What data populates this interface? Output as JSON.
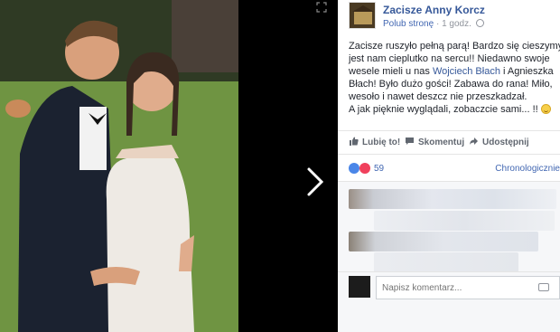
{
  "header": {
    "page_name": "Zacisze Anny Korcz",
    "like_link": "Polub stronę",
    "separator": "·",
    "time": "1 godz."
  },
  "post": {
    "text_before": "Zacisze ruszyło pełną parą! Bardzo się cieszymy, jest nam cieplutko na sercu!! Niedawno swoje wesele mieli u nas ",
    "mention": "Wojciech Błach",
    "text_after": " i Agnieszka Błach! Było dużo gości! Zabawa do rana! Miło, wesoło i nawet deszcz nie przeszkadzał.",
    "line2": "A jak pięknie wyglądali, zobaczcie sami... !! "
  },
  "actions": {
    "like": "Lubię to!",
    "comment": "Skomentuj",
    "share": "Udostępnij"
  },
  "reactions": {
    "count": "59",
    "sort": "Chronologicznie"
  },
  "compose": {
    "placeholder": "Napisz komentarz..."
  },
  "icons": [
    "expand-icon",
    "chevron-right-icon",
    "globe-icon",
    "thumbs-up-icon",
    "comment-icon",
    "share-icon",
    "like-reaction-icon",
    "love-reaction-icon",
    "camera-icon",
    "smile-emoji-icon"
  ],
  "colors": {
    "link": "#365899",
    "accent": "#4267b2",
    "muted": "#90949c",
    "background": "#000000"
  }
}
